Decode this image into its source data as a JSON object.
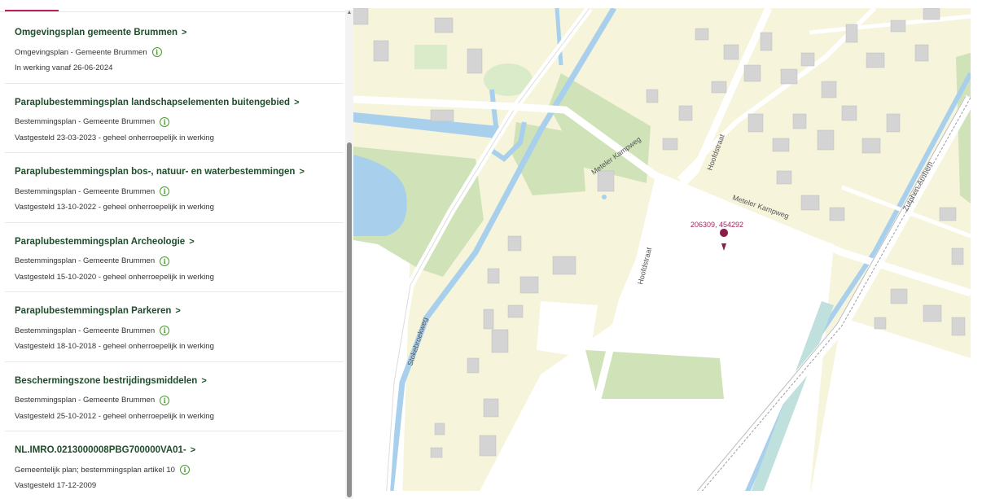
{
  "plans": [
    {
      "title": "Omgevingsplan gemeente Brummen",
      "subtitle": "Omgevingsplan - Gemeente Brummen",
      "status": "In werking vanaf 26-06-2024"
    },
    {
      "title": "Paraplubestemmingsplan landschapselementen buitengebied",
      "subtitle": "Bestemmingsplan - Gemeente Brummen",
      "status": "Vastgesteld 23-03-2023 - geheel onherroepelijk in werking"
    },
    {
      "title": "Paraplubestemmingsplan bos-, natuur- en waterbestemmingen",
      "subtitle": "Bestemmingsplan - Gemeente Brummen",
      "status": "Vastgesteld 13-10-2022 - geheel onherroepelijk in werking"
    },
    {
      "title": "Paraplubestemmingsplan Archeologie",
      "subtitle": "Bestemmingsplan - Gemeente Brummen",
      "status": "Vastgesteld 15-10-2020 - geheel onherroepelijk in werking"
    },
    {
      "title": "Paraplubestemmingsplan Parkeren",
      "subtitle": "Bestemmingsplan - Gemeente Brummen",
      "status": "Vastgesteld 18-10-2018 - geheel onherroepelijk in werking"
    },
    {
      "title": "Beschermingszone bestrijdingsmiddelen",
      "subtitle": "Bestemmingsplan - Gemeente Brummen",
      "status": "Vastgesteld 25-10-2012 - geheel onherroepelijk in werking"
    },
    {
      "title": "NL.IMRO.0213000008PBG700000VA01-",
      "subtitle": "Gemeentelijk plan; bestemmingsplan artikel 10",
      "status": "Vastgesteld 17-12-2009"
    }
  ],
  "map": {
    "streets": [
      "Meteler Kampweg",
      "Meteler Kampweg",
      "Hoofdstraat",
      "Hoofdstraat",
      "Stokebroekweg",
      "Zutphen-Arnhem"
    ],
    "coordinate": "206309, 454292",
    "marker_icon": "map-pin-icon"
  },
  "colors": {
    "accent": "#b8205b",
    "title_green": "#1f4d2b",
    "info_green": "#4a9a2e",
    "water": "#a8d0ec",
    "green_area": "#cfe2b8",
    "built_area": "#f7f4dc"
  }
}
